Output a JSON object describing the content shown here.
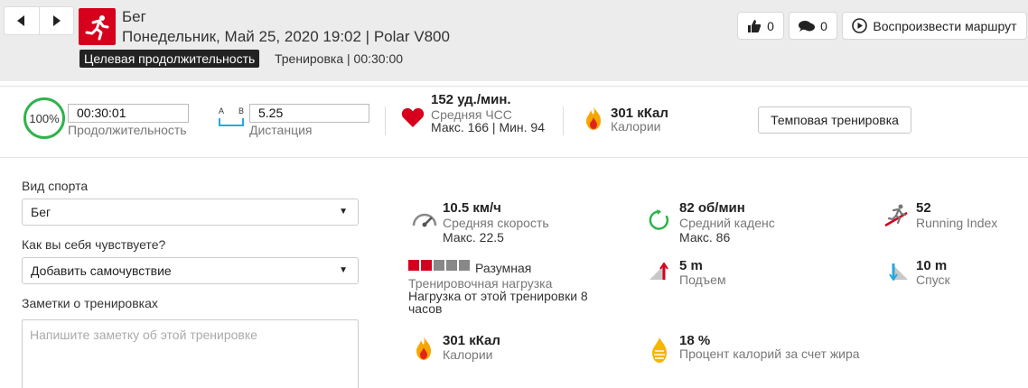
{
  "header": {
    "title": "Бег",
    "subtitle": "Понедельник, Май 25, 2020 19:02 | Polar V800",
    "target_tag": "Целевая продолжительность",
    "target_info": "Тренировка  | 00:30:00",
    "likes": "0",
    "comments": "0",
    "replay_label": "Воспроизвести маршрут",
    "icons": {
      "prev": "chevron-left-icon",
      "next": "chevron-right-icon",
      "sport": "running-icon",
      "like": "thumbs-up-icon",
      "comment": "comment-icon",
      "replay": "play-icon"
    }
  },
  "summary": {
    "progress_percent": "100%",
    "duration_value": "00:30:01",
    "duration_label": "Продолжительность",
    "distance_a": "A",
    "distance_b": "B",
    "distance_value": "5.25",
    "distance_label": "Дистанция",
    "hr_main": "152 уд./мин.",
    "hr_label": "Средняя ЧСС",
    "hr_minmax": "Макс. 166  |  Мин. 94",
    "calories_main": "301 кКал",
    "calories_label": "Калории",
    "tempo_button": "Темповая тренировка"
  },
  "form": {
    "sport_label": "Вид спорта",
    "sport_value": "Бег",
    "feeling_label": "Как вы себя чувствуете?",
    "feeling_value": "Добавить самочувствие",
    "notes_label": "Заметки о тренировках",
    "notes_placeholder": "Напишите заметку об этой тренировке"
  },
  "metrics": {
    "speed_value": "10.5 км/ч",
    "speed_label": "Средняя скорость",
    "speed_max": "Макс. 22.5",
    "cadence_value": "82 об/мин",
    "cadence_label": "Средний каденс",
    "cadence_max": "Макс. 86",
    "running_index_value": "52",
    "running_index_label": "Running Index",
    "load_level_filled": 2,
    "load_level_total": 5,
    "load_level_text": "Разумная",
    "load_label": "Тренировочная нагрузка",
    "load_desc": "Нагрузка от этой тренировки 8 часов",
    "ascent_value": "5 m",
    "ascent_label": "Подъем",
    "descent_value": "10 m",
    "descent_label": "Спуск",
    "calories_value": "301 кКал",
    "calories_label": "Калории",
    "fat_value": "18 %",
    "fat_label": "Процент калорий за счет жира"
  },
  "colors": {
    "brand_red": "#d6001c",
    "progress_green": "#2fb34a",
    "distance_blue": "#29a8e0",
    "load_filled": "#d6001c",
    "load_empty": "#888888"
  }
}
